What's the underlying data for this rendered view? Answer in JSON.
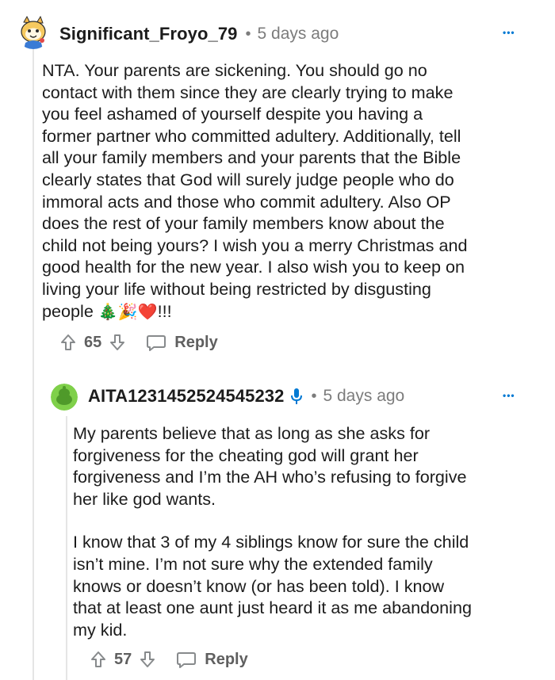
{
  "comment": {
    "username": "Significant_Froyo_79",
    "separator": "•",
    "timestamp": "5 days ago",
    "more_label": "•••",
    "body_lines": [
      "NTA. Your parents are sickening. You should go no",
      "contact with them since they are clearly trying to make",
      "you feel ashamed of yourself despite you having a",
      "former partner who committed adultery. Additionally, tell",
      "all your family members and your parents that the Bible",
      "clearly states that God will surely judge people who do",
      "immoral acts and those who commit adultery. Also OP",
      "does the rest of your family members know about the",
      "child not being yours? I wish you a merry Christmas and",
      "good health for the new year. I also wish you to keep on",
      "living your life without being restricted by disgusting"
    ],
    "body_last_line_text": "people",
    "body_emojis": "🎄🎉❤️",
    "body_last_line_suffix": "!!!",
    "votes": "65",
    "reply_label": "Reply"
  },
  "reply": {
    "username": "AITA1231452524545232",
    "separator": "•",
    "timestamp": "5 days ago",
    "more_label": "•••",
    "paragraph1": [
      "My parents believe that as long as she asks for",
      "forgiveness for the cheating god will grant her",
      "forgiveness and I’m the AH who’s refusing to forgive",
      "her like god wants."
    ],
    "paragraph2": [
      "I know that 3 of my 4 siblings know for sure the child",
      "isn’t mine. I’m not sure why the extended family",
      "knows or doesn’t know (or has been told). I know",
      "that at least one aunt just heard it as me abandoning",
      "my kid."
    ],
    "votes": "57",
    "reply_label": "Reply"
  },
  "colors": {
    "accent": "#0079d3",
    "meta_gray": "#7c7c7c",
    "text": "#1c1c1c",
    "thread_line": "#e5e5e5",
    "reply_avatar_green": "#7fd04a"
  },
  "icons": {
    "comment_avatar": "froyo-snoo-avatar",
    "reply_avatar": "green-snoo-avatar",
    "mic": "microphone-icon",
    "upvote": "arrow-up-icon",
    "downvote": "arrow-down-icon",
    "reply": "speech-bubble-icon",
    "more": "ellipsis-icon"
  }
}
